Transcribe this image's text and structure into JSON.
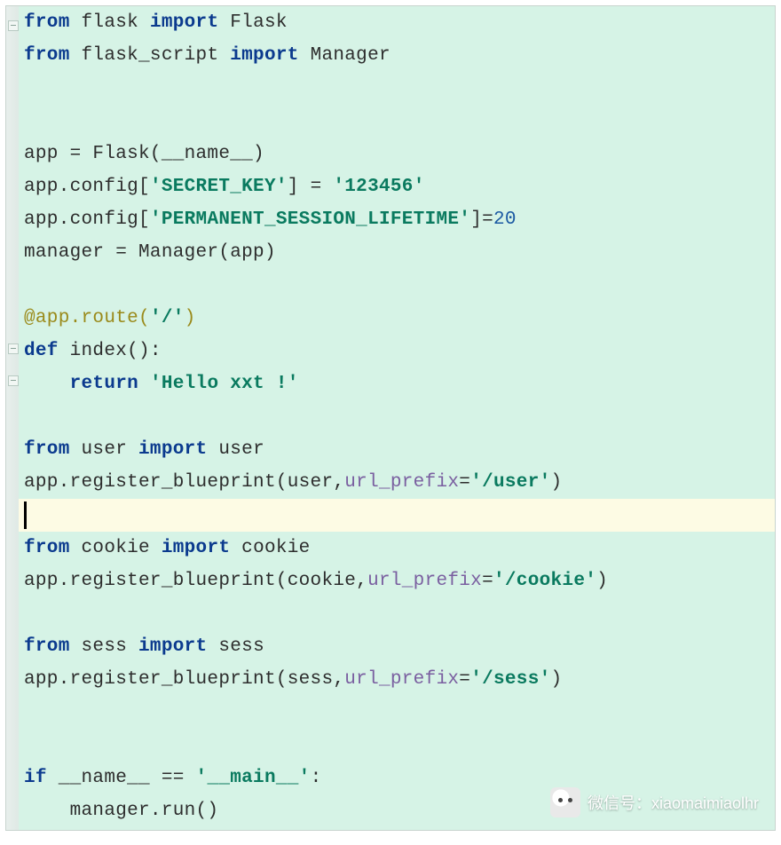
{
  "watermark": {
    "label": "微信号：xiaomaimiaolhr"
  },
  "code": {
    "tokens": {
      "from": "from",
      "import": "import",
      "def": "def",
      "return": "return",
      "if": "if",
      "flask": "flask",
      "Flask": "Flask",
      "flask_script": "flask_script",
      "Manager": "Manager",
      "app_assign": "app = Flask(__name__)",
      "cfg1_pre": "app.config[",
      "cfg1_key": "'SECRET_KEY'",
      "cfg1_mid": "] = ",
      "cfg1_val": "'123456'",
      "cfg2_pre": "app.config[",
      "cfg2_key": "'PERMANENT_SESSION_LIFETIME'",
      "cfg2_mid": "]=",
      "cfg2_val": "20",
      "mgr": "manager = Manager(app)",
      "route_dec": "@app.route",
      "route_open": "(",
      "route_str": "'/'",
      "route_close": ")",
      "def_name": " index():",
      "ret_str": "'Hello xxt !'",
      "user_mod": "user",
      "user_obj": "user",
      "reg1_pre": "app.register_blueprint(user,",
      "reg1_kw": "url_prefix",
      "reg1_eq": "=",
      "reg1_str": "'/user'",
      "reg1_close": ")",
      "cookie_mod": "cookie",
      "cookie_obj": "cookie",
      "reg2_pre": "app.register_blueprint(cookie,",
      "reg2_kw": "url_prefix",
      "reg2_eq": "=",
      "reg2_str": "'/cookie'",
      "reg2_close": ")",
      "sess_mod": "sess",
      "sess_obj": "sess",
      "reg3_pre": "app.register_blueprint(sess,",
      "reg3_kw": "url_prefix",
      "reg3_eq": "=",
      "reg3_str": "'/sess'",
      "reg3_close": ")",
      "if_name": " __name__ == ",
      "main_str": "'__main__'",
      "if_colon": ":",
      "run": "    manager.run()"
    }
  }
}
